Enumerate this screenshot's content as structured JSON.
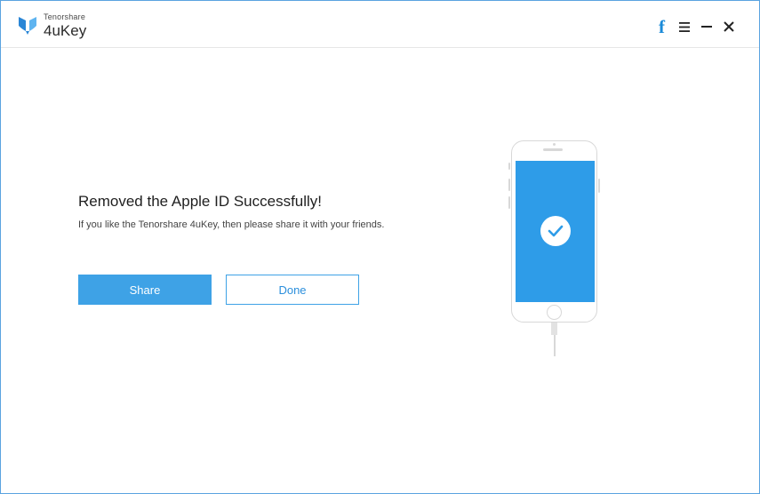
{
  "app": {
    "brand_small": "Tenorshare",
    "brand_name": "4uKey",
    "accent_color": "#3ea2e6"
  },
  "window_controls": {
    "facebook_icon": "f",
    "menu_icon": "menu-icon",
    "minimize_icon": "minimize-icon",
    "close_icon": "close-icon"
  },
  "main": {
    "heading": "Removed the Apple ID Successfully!",
    "subtext": "If you like the Tenorshare 4uKey, then please share it with your friends.",
    "share_label": "Share",
    "done_label": "Done"
  },
  "illustration": {
    "status_icon": "checkmark-icon",
    "screen_color": "#2e9ce8"
  }
}
